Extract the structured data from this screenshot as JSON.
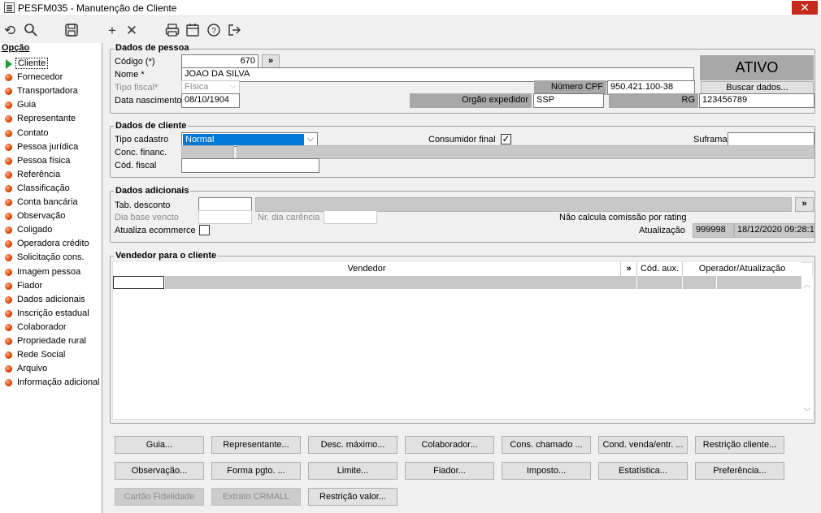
{
  "window": {
    "title": "PESFM035 - Manutenção de Cliente",
    "close_glyph": "✕"
  },
  "toolbar": {
    "icons": [
      "refresh-icon",
      "search-icon",
      "save-icon",
      "add-icon",
      "delete-icon",
      "print-icon",
      "calendar-icon",
      "help-icon",
      "exit-icon"
    ]
  },
  "sidebar": {
    "header": "Opção",
    "items": [
      "Cliente",
      "Fornecedor",
      "Transportadora",
      "Guia",
      "Representante",
      "Contato",
      "Pessoa jurídica",
      "Pessoa física",
      "Referência",
      "Classificação",
      "Conta bancária",
      "Observação",
      "Coligado",
      "Operadora crédito",
      "Solicitação cons.",
      "Imagem pessoa",
      "Fiador",
      "Dados adicionais",
      "Inscrição estadual",
      "Colaborador",
      "Propriedade rural",
      "Rede Social",
      "Arquivo",
      "Informação adicional"
    ]
  },
  "pessoa": {
    "title": "Dados de pessoa",
    "codigo_label": "Código (*)",
    "codigo_value": "670",
    "lookup_label": "»",
    "nome_label": "Nome *",
    "nome_value": "JOAO DA SILVA",
    "tipo_fiscal_label": "Tipo fiscal*",
    "tipo_fiscal_value": "Física",
    "data_nasc_label": "Data nascimento",
    "data_nasc_value": "08/10/1904",
    "status": "ATIVO",
    "cpf_label": "Número CPF",
    "cpf_value": "950.421.100-38",
    "buscar_label": "Buscar dados...",
    "orgao_label": "Orgão expedidor",
    "orgao_value": "SSP",
    "rg_label": "RG",
    "rg_value": "123456789"
  },
  "cliente": {
    "title": "Dados de cliente",
    "tipo_cadastro_label": "Tipo cadastro",
    "tipo_cadastro_value": "Normal",
    "consumidor_label": "Consumidor final",
    "consumidor_checked": "✓",
    "suframa_label": "Suframa",
    "suframa_value": "",
    "conc_financ_label": "Conc. financ.",
    "cod_fiscal_label": "Cód. fiscal",
    "cod_fiscal_value": ""
  },
  "adicionais": {
    "title": "Dados adicionais",
    "tab_desconto_label": "Tab. desconto",
    "lookup_label": "»",
    "dia_base_label": "Dia base vencto",
    "nr_dia_label": "Nr. dia carência",
    "nao_calcula_label": "Não calcula comissão por rating",
    "atualiza_label": "Atualiza ecommerce",
    "atualizacao_label": "Atualização",
    "atualizacao_user": "999998",
    "atualizacao_date": "18/12/2020 09:28:1"
  },
  "vendedor": {
    "title": "Vendedor para o cliente",
    "columns": [
      "Vendedor",
      "»",
      "Cód. aux.",
      "Operador/Atualização"
    ]
  },
  "buttons": {
    "row1": [
      "Guia...",
      "Representante...",
      "Desc. máximo...",
      "Colaborador...",
      "Cons. chamado ...",
      "Cond. venda/entr. ...",
      "Restrição cliente..."
    ],
    "row2": [
      "Observação...",
      "Forma pgto. ...",
      "Limite...",
      "Fiador...",
      "Imposto...",
      "Estatística...",
      "Preferência..."
    ],
    "row3": [
      "Cartão Fidelidade",
      "Extrato CRMALL",
      "Restrição valor..."
    ]
  }
}
